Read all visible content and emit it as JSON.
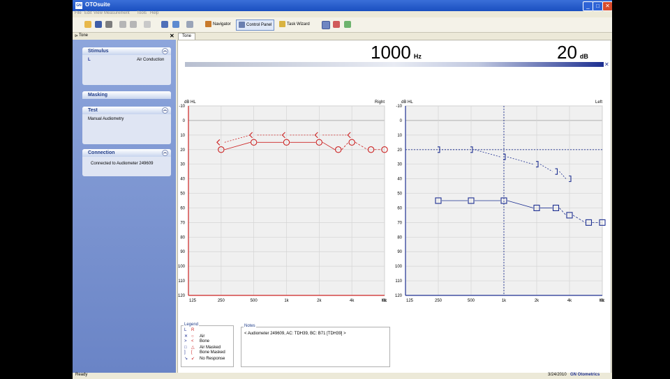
{
  "window": {
    "title": "OTOsuite",
    "logo": "GN"
  },
  "menu": [
    "File",
    "Edit",
    "View",
    "Measurement",
    "Tools",
    "Help"
  ],
  "toolbar": {
    "navigator": "Navigator",
    "control_panel": "Control Panel",
    "task_wizard": "Task Wizard"
  },
  "sidebar": {
    "title": "Tone",
    "stimulus": {
      "header": "Stimulus",
      "ear": "L",
      "type": "Air Conduction"
    },
    "masking": {
      "header": "Masking"
    },
    "test": {
      "header": "Test",
      "value": "Manual Audiometry"
    },
    "connection": {
      "header": "Connection",
      "value": "Connected to Audiometer 249609"
    }
  },
  "tab": "Tone",
  "display": {
    "frequency": "1000",
    "frequency_unit": "Hz",
    "level": "20",
    "level_unit": "dB"
  },
  "colors": {
    "right": "#cc2222",
    "left": "#1d2f91"
  },
  "chart_data": [
    {
      "type": "line",
      "title": "Right",
      "ylabel": "dB HL",
      "xlabel": "Hz",
      "x_ticks": [
        "125",
        "250",
        "500",
        "1k",
        "2k",
        "4k",
        "8k"
      ],
      "y_ticks": [
        "-10",
        "0",
        "10",
        "20",
        "30",
        "40",
        "50",
        "60",
        "70",
        "80",
        "90",
        "100",
        "110",
        "120"
      ],
      "ylim": [
        -10,
        120
      ],
      "series": [
        {
          "name": "Air",
          "marker": "circle",
          "x": [
            250,
            500,
            1000,
            2000,
            3000,
            4000,
            6000,
            8000
          ],
          "y": [
            20,
            15,
            15,
            15,
            20,
            15,
            20,
            20
          ]
        },
        {
          "name": "Bone",
          "marker": "<",
          "x": [
            250,
            500,
            1000,
            2000,
            4000
          ],
          "y": [
            15,
            10,
            10,
            10,
            10
          ]
        }
      ],
      "cursor": null
    },
    {
      "type": "line",
      "title": "Left",
      "ylabel": "dB HL",
      "xlabel": "Hz",
      "x_ticks": [
        "125",
        "250",
        "500",
        "1k",
        "2k",
        "4k",
        "8k"
      ],
      "y_ticks": [
        "-10",
        "0",
        "10",
        "20",
        "30",
        "40",
        "50",
        "60",
        "70",
        "80",
        "90",
        "100",
        "110",
        "120"
      ],
      "ylim": [
        -10,
        120
      ],
      "series": [
        {
          "name": "Air Masked",
          "marker": "square",
          "x": [
            250,
            500,
            1000,
            2000,
            3000,
            4000,
            6000,
            8000
          ],
          "y": [
            55,
            55,
            55,
            60,
            60,
            65,
            70,
            70
          ]
        },
        {
          "name": "Bone Masked",
          "marker": "]",
          "x": [
            250,
            500,
            1000,
            2000,
            3000,
            4000
          ],
          "y": [
            20,
            20,
            25,
            30,
            35,
            40
          ]
        }
      ],
      "cursor": {
        "x": 1000,
        "y": 20
      }
    }
  ],
  "legend": {
    "title": "Legend",
    "header": {
      "l": "L",
      "r": "R"
    },
    "rows": [
      {
        "l": "✕",
        "r": "○",
        "label": "Air"
      },
      {
        "l": ">",
        "r": "<",
        "label": "Bone"
      },
      {
        "l": "□",
        "r": "△",
        "label": "Air Masked"
      },
      {
        "l": "]",
        "r": "[",
        "label": "Bone Masked"
      },
      {
        "l": "↘",
        "r": "↙",
        "label": "No Response"
      }
    ]
  },
  "notes": {
    "title": "Notes",
    "text": "< Audiometer 249609, AC: TDH39, BC: B71 [TDH39] >"
  },
  "status": {
    "left": "Ready",
    "date": "3/24/2010",
    "brand": "GN Otometrics"
  }
}
